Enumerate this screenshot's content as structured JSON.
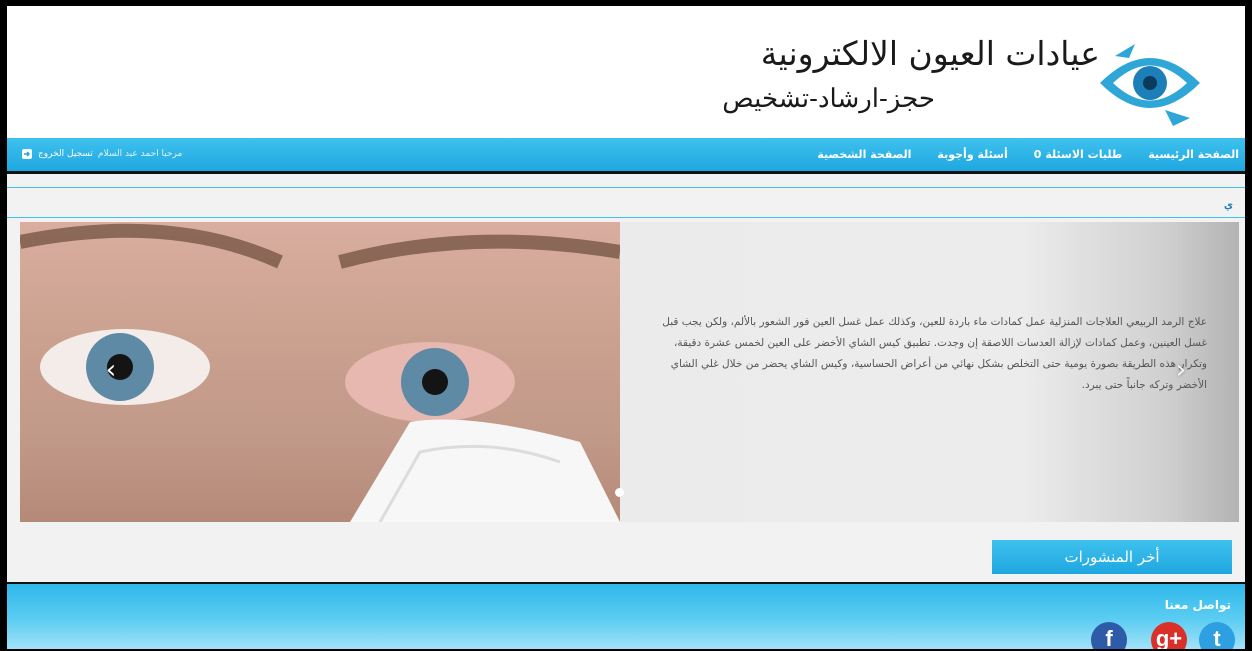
{
  "header": {
    "title": "عيادات العيون الالكترونية",
    "subtitle": "حجز-ارشاد-تشخيص",
    "logo_icon": "eye-logo-icon"
  },
  "navbar": {
    "links": [
      {
        "label": "الصفحة الرئيسية"
      },
      {
        "label": "طلبات الاسئلة",
        "count": "0"
      },
      {
        "label": "أسئلة وأجوبة"
      },
      {
        "label": "الصفحة الشخصية"
      }
    ],
    "welcome": "مرحبا احمد عبد السلام",
    "logout": "تسجيل الخروج",
    "logout_icon": "sign-out-icon"
  },
  "breadcrumb": "ي",
  "slider": {
    "text": "علاج الرمد الربيعي العلاجات المنزلية عمل كمادات ماء باردة للعين، وكذلك عمل غسل العين فور الشعور بالألم، ولكن يجب قبل غسل العينين، وعمل كمادات لإزالة العدسات اللاصقة إن وجدت. تطبيق كيس الشاي الأخضر على العين لخمس عشرة دقيقة، وتكرار هذه الطريقة بصورة يومية حتى التخلص بشكل نهائي من أعراض الحساسية، وكيس الشاي يحضر من خلال غلي الشاي الأخضر وتركه جانباً حتى يبرد.",
    "prev_icon": "chevron-left-icon",
    "next_icon": "chevron-right-icon"
  },
  "latest_posts": "أخر المنشورات",
  "footer": {
    "contact_title": "تواصل معنا",
    "social": [
      {
        "name": "twitter-icon",
        "glyph": "t"
      },
      {
        "name": "google-plus-icon",
        "glyph": "g+"
      },
      {
        "name": "facebook-icon",
        "glyph": "f"
      }
    ]
  },
  "colors": {
    "accent": "#1fa7e0",
    "footer": "#2fb8eb"
  }
}
